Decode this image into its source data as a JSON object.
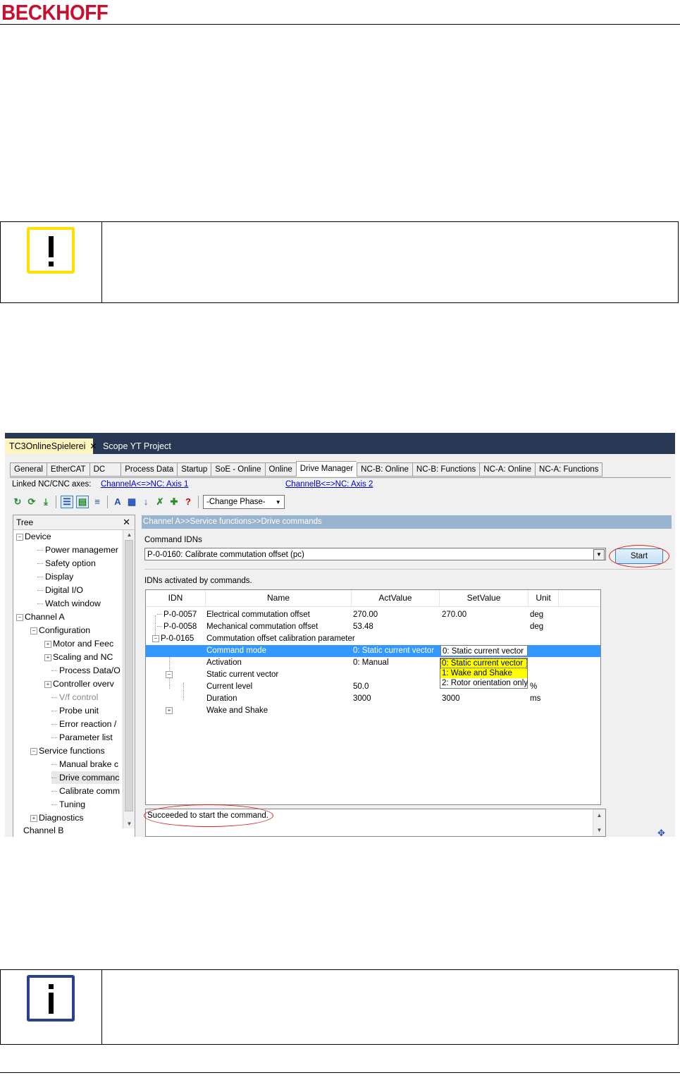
{
  "page": {
    "brand": "BECKHOFF"
  },
  "screenshot": {
    "doc_tabs": {
      "active": "TC3OnlineSpielerei",
      "close": "✕",
      "other": "Scope YT Project"
    },
    "tabs": [
      "General",
      "EtherCAT",
      "DC",
      "Process Data",
      "Startup",
      "SoE - Online",
      "Online",
      "Drive Manager",
      "NC-B: Online",
      "NC-B: Functions",
      "NC-A: Online",
      "NC-A: Functions"
    ],
    "selected_tab": "Drive Manager",
    "linked_label": "Linked NC/CNC axes:",
    "link_a": "ChannelA<=>NC: Axis 1",
    "link_b": "ChannelB<=>NC: Axis 2",
    "toolbar": {
      "help": "?",
      "phase_combo": "-Change Phase-",
      "combo_arrow": "▼"
    },
    "tree": {
      "title": "Tree",
      "close": "✕",
      "nodes": [
        {
          "label": "Device",
          "expander": "−"
        },
        {
          "label": "Power managemer"
        },
        {
          "label": "Safety option"
        },
        {
          "label": "Display"
        },
        {
          "label": "Digital I/O"
        },
        {
          "label": "Watch window"
        },
        {
          "label": "Channel A",
          "expander": "−"
        },
        {
          "label": "Configuration",
          "expander": "−"
        },
        {
          "label": "Motor and Feec",
          "expander": "+"
        },
        {
          "label": "Scaling and NC",
          "expander": "+"
        },
        {
          "label": "Process Data/O"
        },
        {
          "label": "Controller overv",
          "expander": "+"
        },
        {
          "label": "V/f control"
        },
        {
          "label": "Probe unit"
        },
        {
          "label": "Error reaction /"
        },
        {
          "label": "Parameter list"
        },
        {
          "label": "Service functions",
          "expander": "−"
        },
        {
          "label": "Manual brake c"
        },
        {
          "label": "Drive commanc"
        },
        {
          "label": "Calibrate comm"
        },
        {
          "label": "Tuning"
        },
        {
          "label": "Diagnostics",
          "expander": "+"
        },
        {
          "label": "Channel B"
        }
      ]
    },
    "breadcrumb": "Channel A>>Service functions>>Drive commands",
    "command_idns_label": "Command IDNs",
    "command_selected": "P-0-0160: Calibrate commutation offset (pc)",
    "start_button": "Start",
    "idns_activated_label": "IDNs activated by commands.",
    "grid": {
      "headers": [
        "IDN",
        "Name",
        "ActValue",
        "SetValue",
        "Unit"
      ],
      "rows": [
        {
          "idn": "P-0-0057",
          "name": "Electrical commutation offset",
          "act": "270.00",
          "set": "270.00",
          "unit": "deg"
        },
        {
          "idn": "P-0-0058",
          "name": "Mechanical commutation offset",
          "act": "53.48",
          "set": "",
          "unit": "deg"
        },
        {
          "idn": "P-0-0165",
          "name": "Commutation offset calibration parameter",
          "act": "",
          "set": "",
          "unit": ""
        },
        {
          "idn": "",
          "name": "Command mode",
          "act": "0: Static current vector",
          "set": "0: Static current vector",
          "unit": ""
        },
        {
          "idn": "",
          "name": "Activation",
          "act": "0: Manual",
          "set": "",
          "unit": ""
        },
        {
          "idn": "",
          "name": "Static current vector",
          "act": "",
          "set": "",
          "unit": ""
        },
        {
          "idn": "",
          "name": "Current level",
          "act": "50.0",
          "set": "",
          "unit": "%"
        },
        {
          "idn": "",
          "name": "Duration",
          "act": "3000",
          "set": "3000",
          "unit": "ms"
        },
        {
          "idn": "",
          "name": "Wake and Shake",
          "act": "",
          "set": "",
          "unit": ""
        }
      ],
      "dropdown_options": [
        "0: Static current vector",
        "1: Wake and Shake",
        "2: Rotor orientation only"
      ]
    },
    "status_message": "Succeeded to start the command."
  }
}
